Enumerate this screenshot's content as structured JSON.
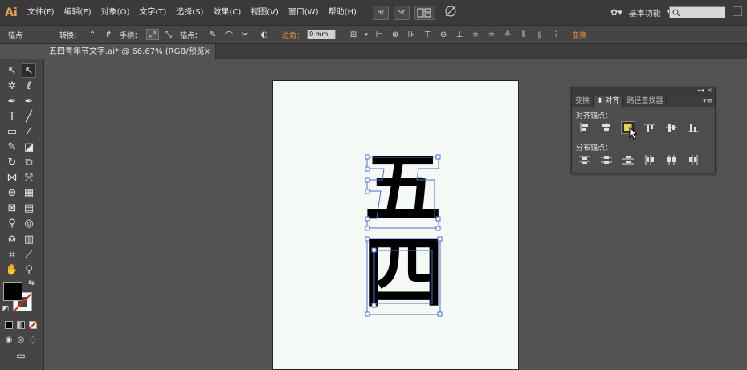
{
  "app": {
    "logo": "Ai"
  },
  "menubar": {
    "items": [
      "文件(F)",
      "编辑(E)",
      "对象(O)",
      "文字(T)",
      "选择(S)",
      "效果(C)",
      "视图(V)",
      "窗口(W)",
      "帮助(H)"
    ],
    "bridge_label": "Br",
    "stock_label": "St",
    "workspace_label": "基本功能",
    "workspace_arrow": "▾"
  },
  "control_bar": {
    "selection_label": "锚点",
    "convert_label": "转换：",
    "handles_label": "手柄：",
    "anchors_label": "锚点：",
    "corner_label": "边角：",
    "corner_value": "0 mm",
    "transform_label": "变换"
  },
  "document": {
    "tab_title": "五四青年节文字.ai* @ 66.67% (RGB/预览)",
    "close_glyph": "×"
  },
  "canvas": {
    "glyph_top": "五",
    "glyph_bottom": "四"
  },
  "align_panel": {
    "tabs": [
      "变换",
      "对齐",
      "路径查找器"
    ],
    "active_tab": 1,
    "align_anchors_label": "对齐锚点：",
    "distribute_anchors_label": "分布锚点："
  },
  "colors": {
    "accent_orange": "#e08a3a",
    "selection_blue": "#4a6fd8",
    "ui_dark": "#3a3a3a",
    "ui_mid": "#454545",
    "canvas_bg": "#535353"
  }
}
